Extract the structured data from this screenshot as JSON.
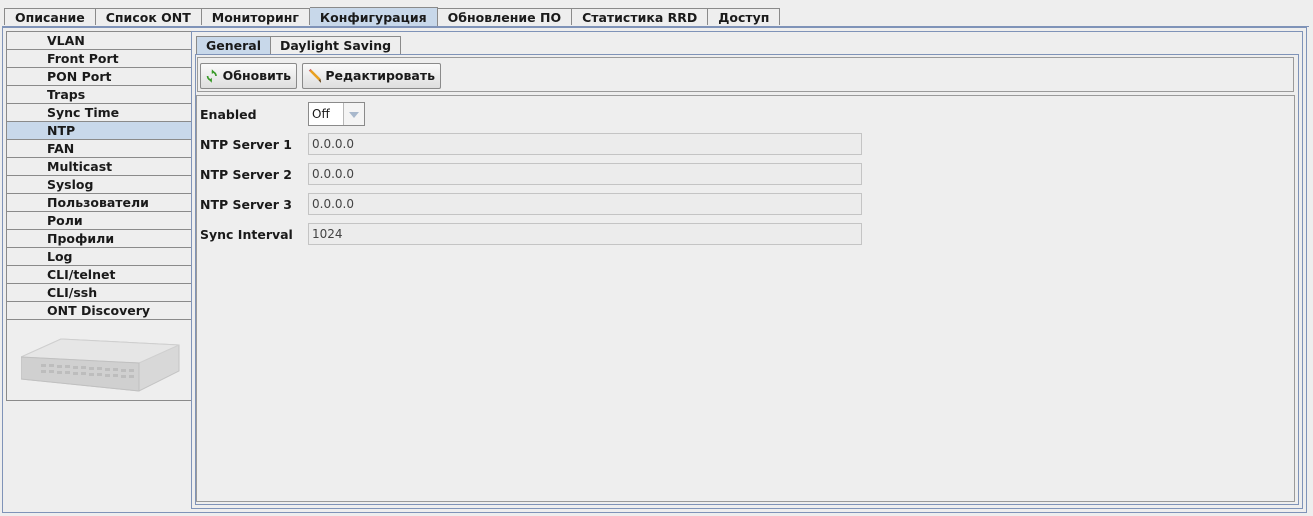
{
  "top_tabs": [
    "Описание",
    "Список ONT",
    "Мониторинг",
    "Конфигурация",
    "Обновление ПО",
    "Статистика RRD",
    "Доступ"
  ],
  "top_tab_active": "Конфигурация",
  "sidebar": {
    "items": [
      "VLAN",
      "Front Port",
      "PON Port",
      "Traps",
      "Sync Time",
      "NTP",
      "FAN",
      "Multicast",
      "Syslog",
      "Пользователи",
      "Роли",
      "Профили",
      "Log",
      "CLI/telnet",
      "CLI/ssh",
      "ONT Discovery"
    ],
    "active": "NTP"
  },
  "sub_tabs": [
    "General",
    "Daylight Saving"
  ],
  "sub_tab_active": "General",
  "toolbar": {
    "refresh_label": "Обновить",
    "edit_label": "Редактировать"
  },
  "form": {
    "enabled_label": "Enabled",
    "enabled_value": "Off",
    "ntp1_label": "NTP Server 1",
    "ntp1_value": "0.0.0.0",
    "ntp2_label": "NTP Server 2",
    "ntp2_value": "0.0.0.0",
    "ntp3_label": "NTP Server 3",
    "ntp3_value": "0.0.0.0",
    "interval_label": "Sync Interval",
    "interval_value": "1024"
  },
  "colors": {
    "active_tab": "#c8d8ea",
    "border_blue": "#7f93b8",
    "background": "#eeeeee"
  },
  "icons": {
    "refresh": "refresh-icon",
    "edit": "pencil-icon",
    "combo_arrow": "chevron-down-icon",
    "device": "olt-device-image"
  }
}
